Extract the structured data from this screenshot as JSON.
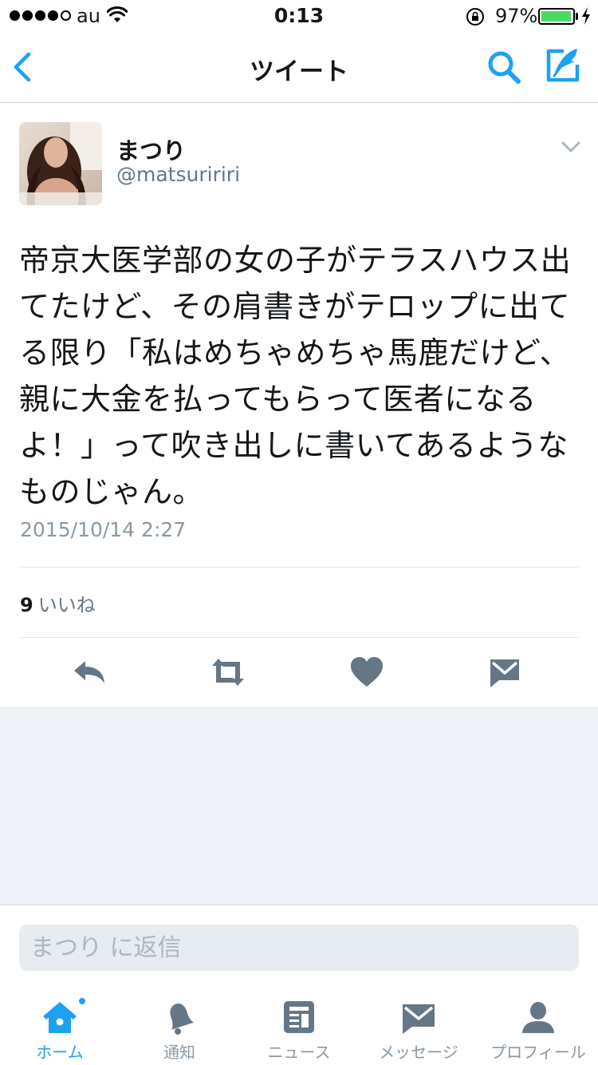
{
  "status_bar": {
    "carrier": "au",
    "time": "0:13",
    "battery": "97%",
    "battery_level": 0.97
  },
  "nav": {
    "title": "ツイート",
    "accent": "#1da1f2"
  },
  "tweet": {
    "author_name": "まつり",
    "author_handle": "@matsuririri",
    "text": "帝京大医学部の女の子がテラスハウス出てたけど、その肩書きがテロップに出てる限り「私はめちゃめちゃ馬鹿だけど、親に大金を払ってもらって医者になるよ！」って吹き出しに書いてあるようなものじゃん。",
    "timestamp": "2015/10/14 2:27",
    "likes_count": "9",
    "likes_label": "いいね"
  },
  "actions": [
    "reply-icon",
    "retweet-icon",
    "heart-icon",
    "message-icon"
  ],
  "reply": {
    "placeholder": "まつり に返信"
  },
  "tabs": [
    {
      "label": "ホーム",
      "icon": "home-icon",
      "active": true
    },
    {
      "label": "通知",
      "icon": "bell-icon",
      "active": false
    },
    {
      "label": "ニュース",
      "icon": "news-icon",
      "active": false
    },
    {
      "label": "メッセージ",
      "icon": "envelope-icon",
      "active": false
    },
    {
      "label": "プロフィール",
      "icon": "person-icon",
      "active": false
    }
  ]
}
